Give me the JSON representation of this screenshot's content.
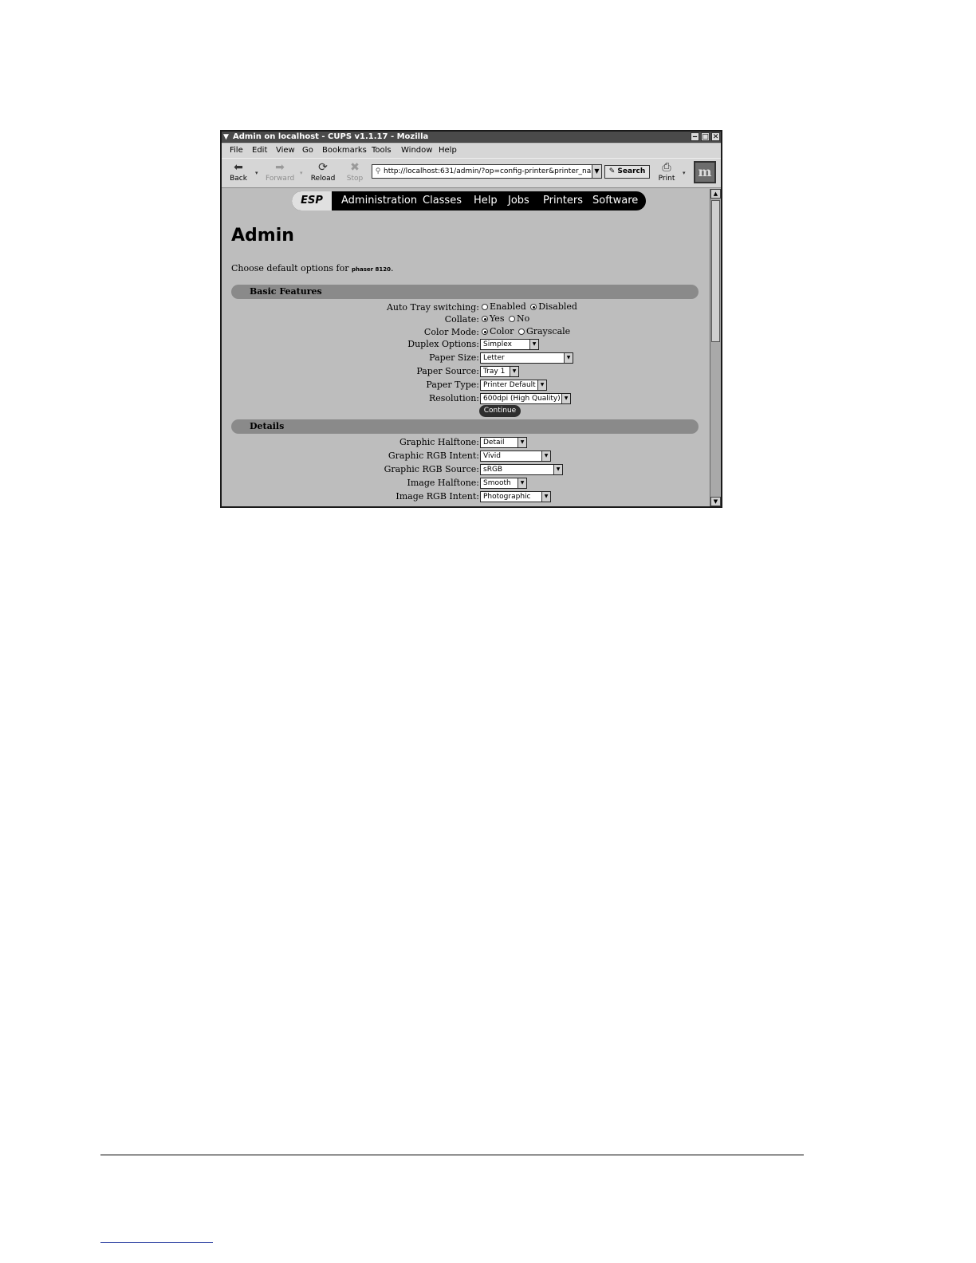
{
  "window": {
    "title": "Admin on localhost - CUPS v1.1.17 - Mozilla",
    "controls": [
      "‒",
      "□",
      "✕"
    ]
  },
  "menubar": [
    "File",
    "Edit",
    "View",
    "Go",
    "Bookmarks",
    "Tools",
    "Window",
    "Help"
  ],
  "toolbar": {
    "back": "Back",
    "forward": "Forward",
    "reload": "Reload",
    "stop": "Stop",
    "url": "http://localhost:631/admin/?op=config-printer&printer_nan",
    "search": "Search",
    "print": "Print"
  },
  "nav": {
    "esp": "ESP",
    "items": [
      "Administration",
      "Classes",
      "Help",
      "Jobs",
      "Printers",
      "Software"
    ]
  },
  "page": {
    "title": "Admin",
    "intro": "Choose default options for ",
    "printer_name": "phaser 8120",
    "intro_end": "."
  },
  "basic": {
    "heading": "Basic Features",
    "auto_tray": {
      "label": "Auto Tray switching:",
      "opt1": "Enabled",
      "opt2": "Disabled"
    },
    "collate": {
      "label": "Collate:",
      "opt1": "Yes",
      "opt2": "No"
    },
    "color_mode": {
      "label": "Color Mode:",
      "opt1": "Color",
      "opt2": "Grayscale"
    },
    "duplex": {
      "label": "Duplex Options:",
      "value": "Simplex"
    },
    "paper_size": {
      "label": "Paper Size:",
      "value": "Letter"
    },
    "paper_source": {
      "label": "Paper Source:",
      "value": "Tray 1"
    },
    "paper_type": {
      "label": "Paper Type:",
      "value": "Printer Default"
    },
    "resolution": {
      "label": "Resolution:",
      "value": "600dpi (High Quality)"
    },
    "continue": "Continue"
  },
  "details": {
    "heading": "Details",
    "graphic_halftone": {
      "label": "Graphic Halftone:",
      "value": "Detail"
    },
    "graphic_rgb_intent": {
      "label": "Graphic RGB Intent:",
      "value": "Vivid"
    },
    "graphic_rgb_source": {
      "label": "Graphic RGB Source:",
      "value": "sRGB"
    },
    "image_halftone": {
      "label": "Image Halftone:",
      "value": "Smooth"
    },
    "image_rgb_intent": {
      "label": "Image RGB Intent:",
      "value": "Photographic"
    }
  }
}
